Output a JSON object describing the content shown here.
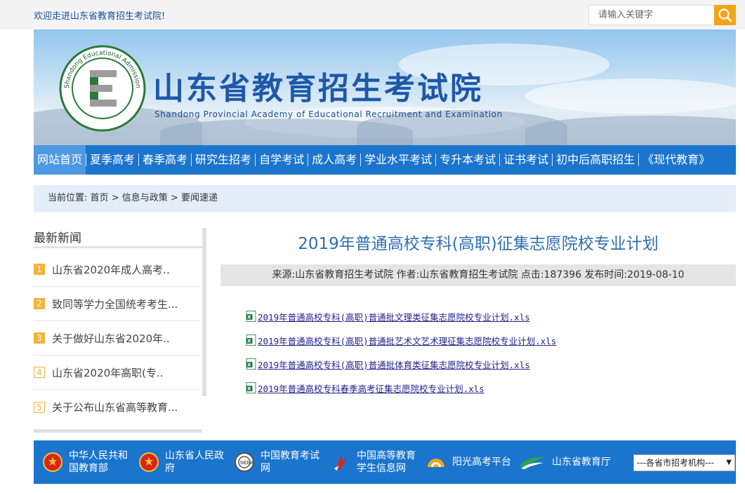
{
  "header": {
    "welcome_text": "欢迎走进山东省教育招生考试院!",
    "search_placeholder": "请输入关键字"
  },
  "banner": {
    "title": "山东省教育招生考试院",
    "subtitle": "Shandong Provincial Academy of Educational Recruitment and Examination"
  },
  "nav": {
    "items": [
      "网站首页",
      "夏季高考",
      "春季高考",
      "研究生招考",
      "自学考试",
      "成人高考",
      "学业水平考试",
      "专升本考试",
      "证书考试",
      "初中后高职招生",
      "《现代教育》"
    ]
  },
  "breadcrumb": {
    "label": "当前位置:",
    "path": [
      "首页",
      "信息与政策",
      "要闻速递"
    ],
    "separator": ">"
  },
  "sidebar": {
    "heading": "最新新闻",
    "items": [
      {
        "num": "1",
        "text": "山东省2020年成人高考.."
      },
      {
        "num": "2",
        "text": "致同等学力全国统考考生..."
      },
      {
        "num": "3",
        "text": "关于做好山东省2020年.."
      },
      {
        "num": "4",
        "text": "山东省2020年高职(专.."
      },
      {
        "num": "5",
        "text": "关于公布山东省高等教育..."
      }
    ]
  },
  "article": {
    "title": "2019年普通高校专科(高职)征集志愿院校专业计划",
    "meta": "来源:山东省教育招生考试院 作者:山东省教育招生考试院 点击:187396 发布时间:2019-08-10",
    "attachments": [
      "2019年普通高校专科(高职)普通批文理类征集志愿院校专业计划.xls",
      "2019年普通高校专科(高职)普通批艺术文艺术理征集志愿院校专业计划.xls",
      "2019年普通高校专科(高职)普通批体育类征集志愿院校专业计划.xls",
      "2019年普通高校专科春季高考征集志愿院校专业计划.xls"
    ]
  },
  "footer": {
    "links": [
      {
        "line1": "中华人民共和",
        "line2": "国教育部",
        "icon": "national-emblem-icon"
      },
      {
        "line1": "山东省人民政",
        "line2": "府",
        "icon": "national-emblem-icon"
      },
      {
        "line1": "中国教育考试",
        "line2": "网",
        "icon": "exam-network-icon"
      },
      {
        "line1": "中国高等教育",
        "line2": "学生信息网",
        "icon": "chsi-icon"
      },
      {
        "line1": "阳光高考平台",
        "line2": "",
        "icon": "sunshine-icon"
      },
      {
        "line1": "山东省教育厅",
        "line2": "",
        "icon": "education-dept-icon"
      }
    ],
    "select_value": "---各省市招考机构---"
  },
  "colors": {
    "nav_blue": "#1b75cd",
    "nav_active": "#4d9ae2",
    "search_orange": "#f5a418",
    "title_blue": "#2f6db3",
    "number_orange": "#f4b33b"
  }
}
